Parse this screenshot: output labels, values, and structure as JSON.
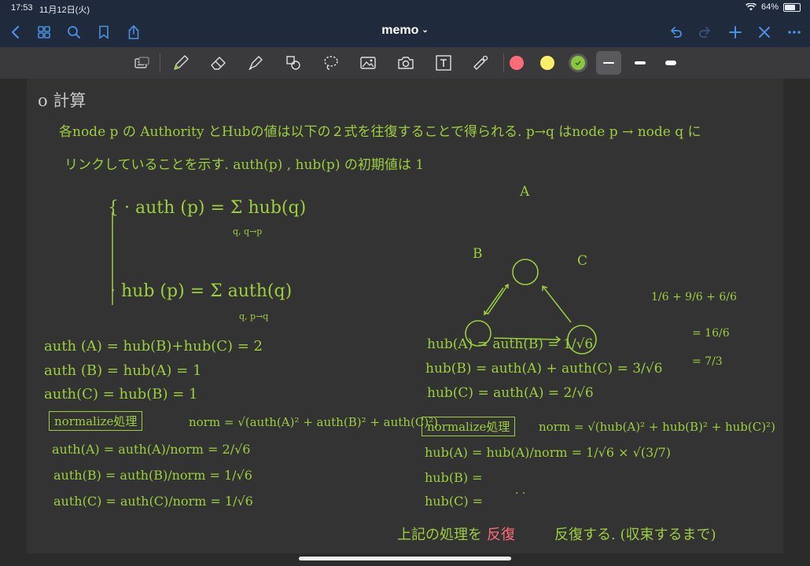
{
  "status_bar": {
    "time": "17:53",
    "date": "11月12日(火)",
    "battery": "64%"
  },
  "nav": {
    "title": "memo",
    "icons": [
      "chevron-left-icon",
      "grid-icon",
      "search-icon",
      "bookmark-icon",
      "share-icon",
      "undo-icon",
      "redo-icon",
      "plus-icon",
      "close-icon",
      "more-icon"
    ]
  },
  "toolbar": {
    "tools": [
      "keyboard-icon",
      "pen-icon",
      "eraser-icon",
      "highlighter-icon",
      "shapes-icon",
      "lasso-icon",
      "image-icon",
      "camera-icon",
      "text-box-icon",
      "laser-pointer-icon"
    ],
    "colors": [
      "#ff6b7a",
      "#ffee66",
      "#8cc63f"
    ],
    "selected_color": "#8cc63f",
    "stroke_widths": [
      "thin",
      "medium",
      "thick"
    ],
    "selected_stroke": "thin"
  },
  "notes": {
    "heading": "o 計算",
    "intro_line1": "各node p の Authority とHubの値は以下の２式を往復することで得られる. p→q はnode p → node q に",
    "intro_line2": "リンクしていることを示す.   auth(p) , hub(p) の初期値は 1",
    "eq_auth": "{ · auth (p) = Σ hub(q)",
    "eq_auth_sub": "q, q→p",
    "eq_hub": "· hub (p) = Σ auth(q)",
    "eq_hub_sub": "q, p→q",
    "diagram": {
      "a": "A",
      "b": "B",
      "c": "C"
    },
    "frac_line1": "1/6 + 9/6 + 6/6",
    "frac_line2": "= 16/6",
    "frac_line3": "= 7/3",
    "auth_a": "auth (A) = hub(B)+hub(C) = 2",
    "auth_b": "auth (B) = hub(A) = 1",
    "auth_c": "auth(C) = hub(B) = 1",
    "hub_a": "hub(A) = auth(B) = 1/√6",
    "hub_b": "hub(B) = auth(A) + auth(C) = 3/√6",
    "hub_c": "hub(C) = auth(A) = 2/√6",
    "normalize_left_box": "normalize処理",
    "norm_left": "norm = √(auth(A)² + auth(B)² + auth(C)²)",
    "norm_auth_a": "auth(A) = auth(A)/norm = 2/√6",
    "norm_auth_b": "auth(B) = auth(B)/norm = 1/√6",
    "norm_auth_c": "auth(C) = auth(C)/norm = 1/√6",
    "normalize_right_box": "normalize処理",
    "norm_right": "norm = √(hub(A)² + hub(B)² + hub(C)²)",
    "norm_hub_a": "hub(A) = hub(A)/norm = 1/√6 × √(3/7)",
    "norm_hub_b": "hub(B) =",
    "norm_hub_c": "hub(C) =",
    "dots": "· ·",
    "footer_pre": "上記の処理を",
    "footer_red": "反復",
    "footer_post": "反復する. (収束するまで)"
  }
}
